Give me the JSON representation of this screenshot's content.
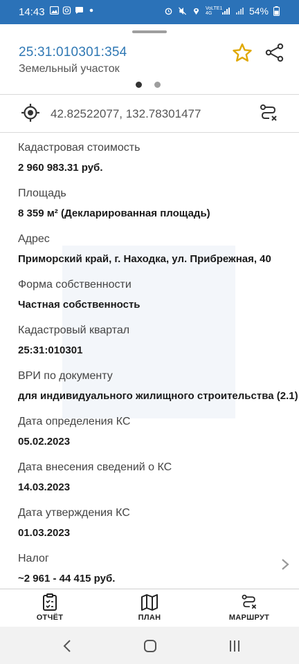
{
  "status_bar": {
    "time": "14:43",
    "network": "VoLTE1 4G",
    "battery": "54%"
  },
  "header": {
    "cadastral_number": "25:31:010301:354",
    "object_type": "Земельный участок",
    "pages": 2,
    "current_page": 1
  },
  "coords": {
    "value": "42.82522077, 132.78301477"
  },
  "fields": [
    {
      "label": "Кадастровая стоимость",
      "value": "2 960 983.31 руб."
    },
    {
      "label": "Площадь",
      "value": "8 359 м² (Декларированная площадь)"
    },
    {
      "label": "Адрес",
      "value": "Приморский край, г. Находка, ул. Прибрежная, 40"
    },
    {
      "label": "Форма собственности",
      "value": "Частная собственность"
    },
    {
      "label": "Кадастровый квартал",
      "value": "25:31:010301"
    },
    {
      "label": "ВРИ по документу",
      "value": "для индивидуального жилищного строительства (2.1)"
    },
    {
      "label": "Дата определения КС",
      "value": "05.02.2023"
    },
    {
      "label": "Дата внесения сведений о КС",
      "value": "14.03.2023"
    },
    {
      "label": "Дата утверждения КС",
      "value": "01.03.2023"
    },
    {
      "label": "Налог",
      "value": "~2 961 - 44 415 руб."
    }
  ],
  "bottom_nav": {
    "report": "ОТЧЁТ",
    "plan": "ПЛАН",
    "route": "МАРШРУТ"
  },
  "colors": {
    "status_bar": "#2b72b8",
    "accent": "#2f78b4",
    "star": "#e0a800"
  }
}
